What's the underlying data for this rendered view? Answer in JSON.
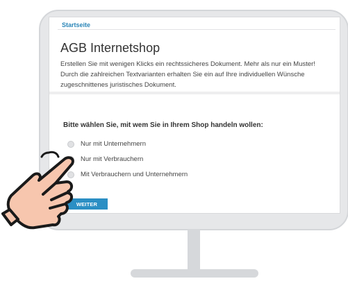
{
  "breadcrumb": "Startseite",
  "title": "AGB Internetshop",
  "intro": "Erstellen Sie mit wenigen Klicks ein rechtssicheres Dokument. Mehr als nur ein Muster! Durch die zahlreichen Textvarianten erhalten Sie ein auf Ihre individuellen Wünsche zugeschnittenes juristisches Dokument.",
  "question": "Bitte wählen Sie, mit wem Sie in Ihrem Shop handeln wollen:",
  "options": [
    {
      "label": "Nur mit Unternehmern"
    },
    {
      "label": "Nur mit Verbrauchern"
    },
    {
      "label": "Mit Verbrauchern und Unternehmern"
    }
  ],
  "button": {
    "label": "WEITER"
  },
  "icons": {
    "pointer": "pointing-hand-icon"
  },
  "colors": {
    "accent": "#2b8fc4",
    "link": "#2b86b8",
    "monitor": "#e6e7e9",
    "hand": "#f7c6ae"
  }
}
